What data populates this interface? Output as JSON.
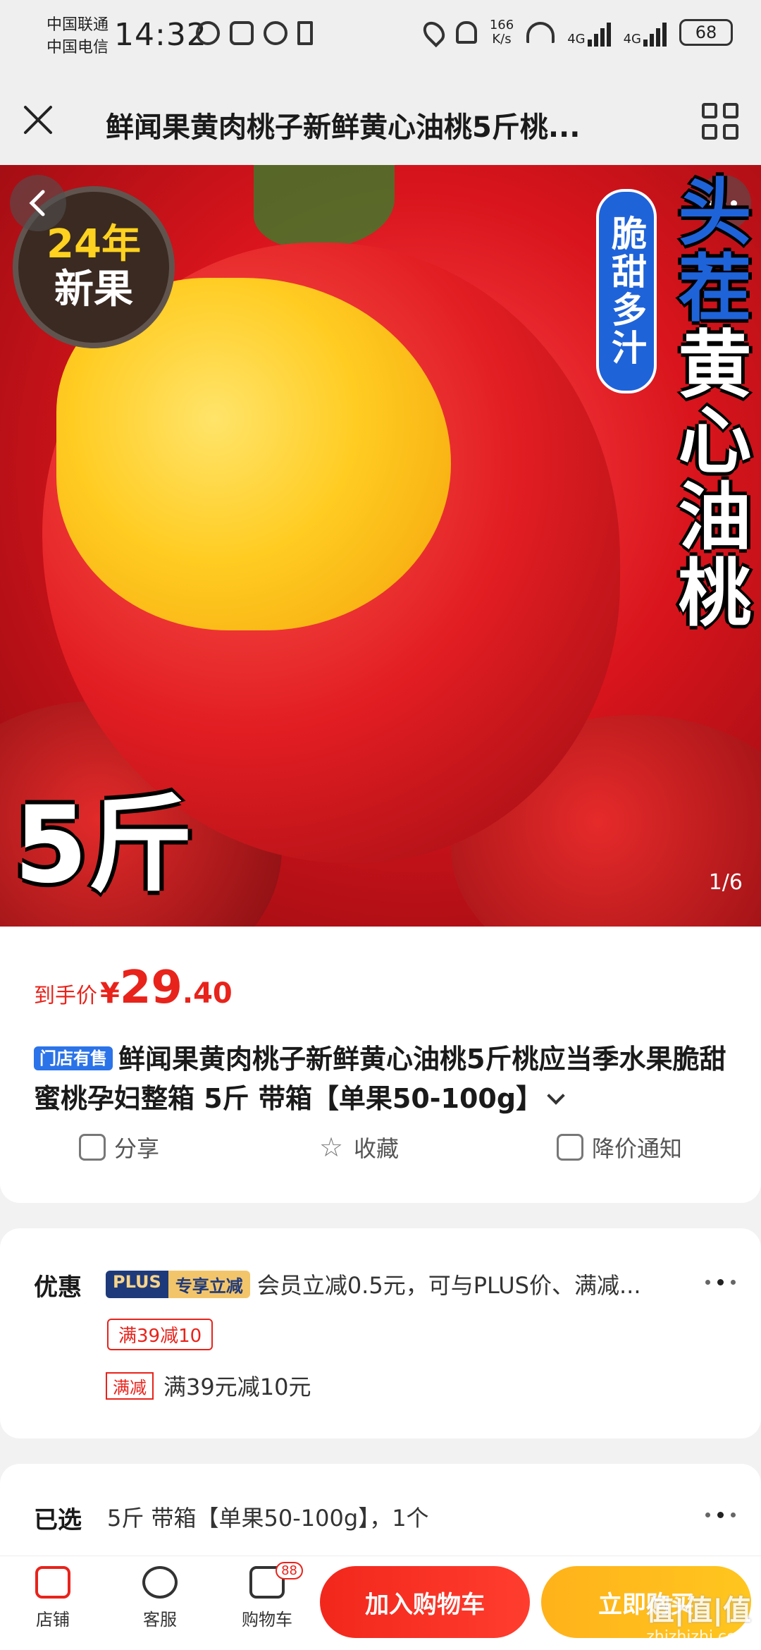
{
  "status_bar": {
    "carrier_1": "中国联通",
    "carrier_2": "中国电信",
    "time": "14:32",
    "net_speed_value": "166",
    "net_speed_unit": "K/s",
    "signal_1": "4G",
    "signal_2": "4G",
    "battery": "68"
  },
  "nav": {
    "title": "鲜闻果黄肉桃子新鲜黄心油桃5斤桃..."
  },
  "hero": {
    "badge_line1": "24年",
    "badge_line2": "新果",
    "tag": "脆甜多汁",
    "title_top": "头茬",
    "title_main": "黄心油桃",
    "weight": "5斤",
    "pager": "1/6"
  },
  "price": {
    "label": "到手价",
    "currency": "¥",
    "integer": "29",
    "decimal": ".40"
  },
  "product": {
    "store_tag": "门店有售",
    "title": "鲜闻果黄肉桃子新鲜黄心油桃5斤桃应当季水果脆甜蜜桃孕妇整箱 5斤 带箱【单果50-100g】"
  },
  "actions": {
    "share": "分享",
    "favorite": "收藏",
    "price_alert": "降价通知"
  },
  "discount": {
    "label": "优惠",
    "plus_tag_a": "PLUS",
    "plus_tag_b": "专享立减",
    "plus_text": "会员立减0.5元，可与PLUS价、满减...",
    "coupon": "满39减10",
    "full_tag": "满减",
    "full_text": "满39元减10元"
  },
  "selected": {
    "label": "已选",
    "value": "5斤 带箱【单果50-100g】，1个"
  },
  "bottom_bar": {
    "store": "店铺",
    "service": "客服",
    "cart": "购物车",
    "cart_count": "88",
    "add_to_cart": "加入购物车",
    "buy_now": "立即购买"
  },
  "watermark": {
    "brand": "值|值|值",
    "url": "zhizhizhi.com"
  },
  "colors": {
    "accent_red": "#e8231b",
    "buy_yellow": "#ffc61f",
    "plus_navy": "#1f3a7a"
  }
}
